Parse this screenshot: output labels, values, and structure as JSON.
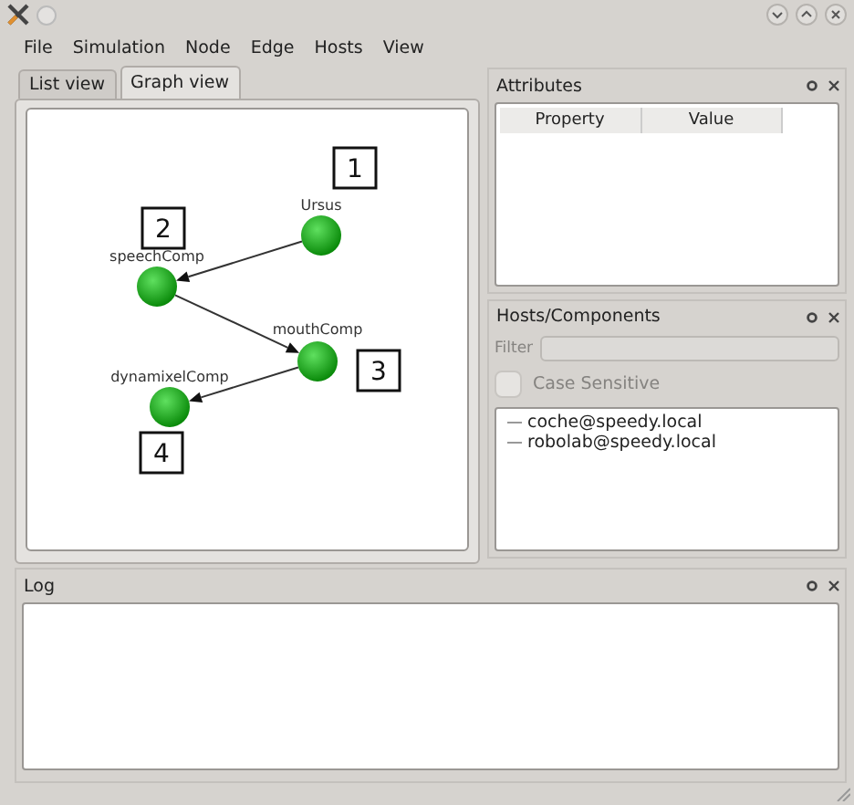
{
  "menu": [
    "File",
    "Simulation",
    "Node",
    "Edge",
    "Hosts",
    "View"
  ],
  "tabs": [
    {
      "label": "List view",
      "selected": false
    },
    {
      "label": "Graph view",
      "selected": true
    }
  ],
  "graph": {
    "nodes": [
      {
        "label": "Ursus",
        "number": "1",
        "edge_to_next": true
      },
      {
        "label": "speechComp",
        "number": "2",
        "edge_to_next": true
      },
      {
        "label": "mouthComp",
        "number": "3",
        "edge_to_next": true
      },
      {
        "label": "dynamixelComp",
        "number": "4"
      }
    ]
  },
  "attributes": {
    "title": "Attributes",
    "columns": [
      "Property",
      "Value"
    ]
  },
  "hosts": {
    "title": "Hosts/Components",
    "filter_label": "Filter",
    "case_sensitive": {
      "label": "Case Sensitive",
      "checked": false,
      "disabled": true
    },
    "items": [
      "coche@speedy.local",
      "robolab@speedy.local"
    ]
  },
  "log": {
    "title": "Log"
  }
}
